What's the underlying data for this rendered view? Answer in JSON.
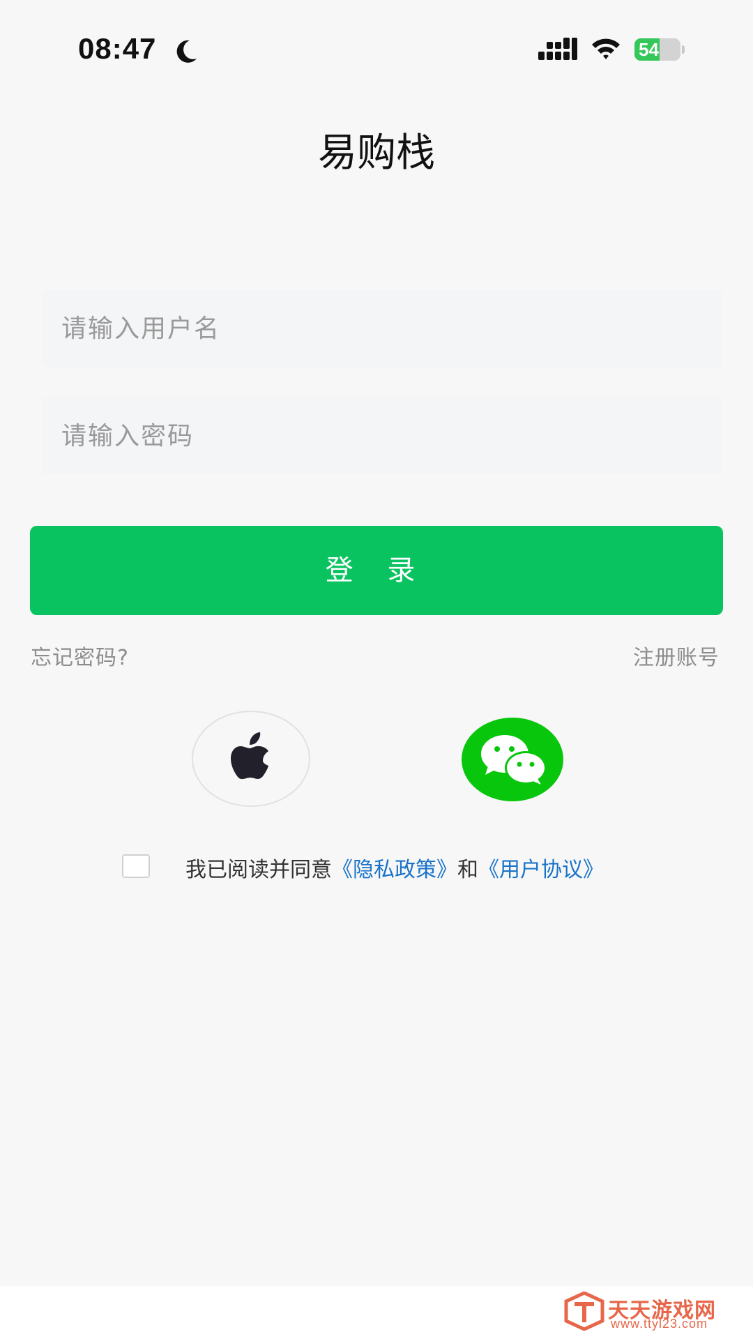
{
  "status_bar": {
    "time": "08:47",
    "battery_level": "54",
    "battery_fraction": 0.54,
    "icons": [
      "moon-icon",
      "signal-icon",
      "wifi-icon",
      "battery-charging-icon"
    ]
  },
  "app": {
    "title": "易购栈"
  },
  "form": {
    "username_placeholder": "请输入用户名",
    "username_value": "",
    "password_placeholder": "请输入密码",
    "password_value": "",
    "login_label": "登 录",
    "forgot_password": "忘记密码?",
    "register": "注册账号"
  },
  "social_login": {
    "apple_icon": "apple-icon",
    "wechat_icon": "wechat-icon"
  },
  "agreement": {
    "prefix": "我已阅读并同意",
    "privacy_policy": "《隐私政策》",
    "connector": "和",
    "user_agreement": "《用户协议》",
    "checked": false
  },
  "watermark": {
    "name": "天天游戏网",
    "url": "www.ttyl23.com"
  },
  "colors": {
    "accent": "#08c35f",
    "wechat": "#08c60c",
    "link": "#1a73c9",
    "background": "#f7f7f7"
  }
}
